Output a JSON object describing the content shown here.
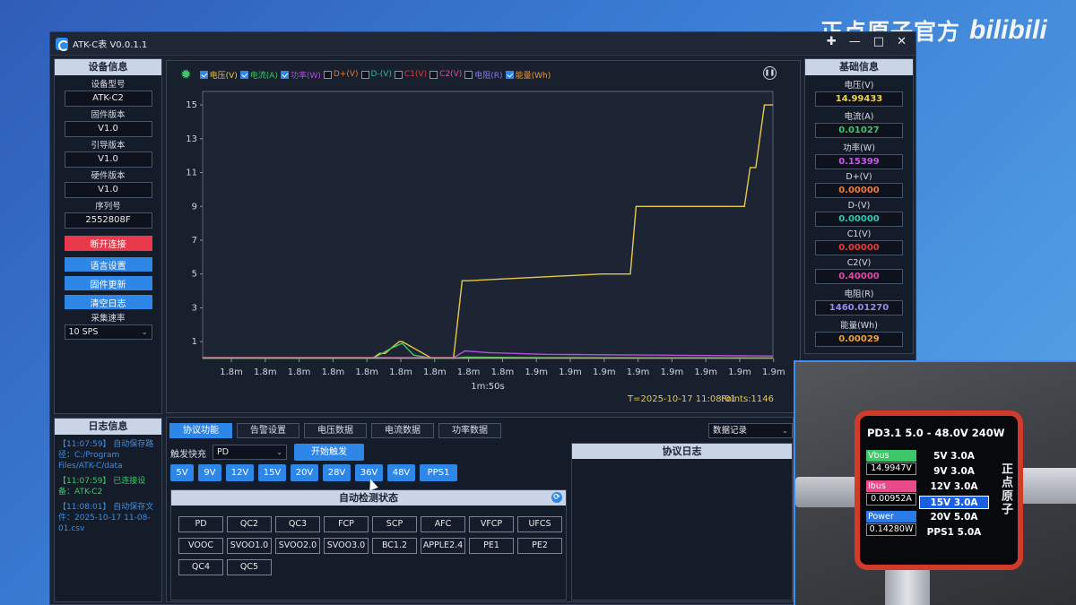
{
  "watermark": {
    "brand": "正点原子官方",
    "site": "bilibili"
  },
  "app": {
    "title": "ATK-C表 V0.0.1.1"
  },
  "device_info": {
    "title": "设备信息",
    "fields": [
      {
        "label": "设备型号",
        "value": "ATK-C2"
      },
      {
        "label": "固件版本",
        "value": "V1.0"
      },
      {
        "label": "引导版本",
        "value": "V1.0"
      },
      {
        "label": "硬件版本",
        "value": "V1.0"
      },
      {
        "label": "序列号",
        "value": "2552808F"
      }
    ],
    "disconnect": "断开连接",
    "lang": "语言设置",
    "fw_update": "固件更新",
    "clear_log": "清空日志",
    "rate_label": "采集速率",
    "rate_value": "10 SPS"
  },
  "log": {
    "title": "日志信息",
    "entries": [
      {
        "text": "【11:07:59】 自动保存路径：C:/Program Files/ATK-C/data",
        "color": "blue"
      },
      {
        "text": "【11:07:59】 已连接设备：ATK-C2",
        "color": "green"
      },
      {
        "text": "【11:08:01】 自动保存文件：2025-10-17 11-08-01.csv",
        "color": "blue"
      }
    ]
  },
  "legend": [
    {
      "label": "电压(V)",
      "checked": true,
      "color": "#e8c84a"
    },
    {
      "label": "电流(A)",
      "checked": true,
      "color": "#3ec66b"
    },
    {
      "label": "功率(W)",
      "checked": true,
      "color": "#b04fe0"
    },
    {
      "label": "D+(V)",
      "checked": false,
      "color": "#e07a3a"
    },
    {
      "label": "D-(V)",
      "checked": false,
      "color": "#2fb8a8"
    },
    {
      "label": "C1(V)",
      "checked": false,
      "color": "#e03a3a"
    },
    {
      "label": "C2(V)",
      "checked": false,
      "color": "#e04aa8"
    },
    {
      "label": "电阻(R)",
      "checked": false,
      "color": "#8a7ae8"
    },
    {
      "label": "能量(Wh)",
      "checked": true,
      "color": "#e89a3a"
    }
  ],
  "chart_data": {
    "type": "line",
    "y_ticks": [
      "15",
      "13",
      "11",
      "9",
      "7",
      "5",
      "3",
      "1"
    ],
    "ylim": [
      0,
      15.8
    ],
    "x_ticks": [
      "1.8m",
      "1.8m",
      "1.8m",
      "1.8m",
      "1.8m",
      "1.8m",
      "1.8m",
      "1.8m",
      "1.8m",
      "1.9m",
      "1.9m",
      "1.9m",
      "1.9m",
      "1.9m",
      "1.9m",
      "1.9m",
      "1.9m"
    ],
    "x_center_label": "1m:50s",
    "timestamp": "T=2025-10-17 11:08:01",
    "points": "Points:1146",
    "series": [
      {
        "color": "#e8c84a",
        "x": [
          0,
          0.3,
          0.31,
          0.32,
          0.33,
          0.345,
          0.35,
          0.4,
          0.41,
          0.42,
          0.43,
          0.44,
          0.455,
          0.465,
          0.7,
          0.71,
          0.75,
          0.76,
          0.94,
          0.95,
          0.96,
          0.97,
          0.985,
          0.99,
          1.0
        ],
        "y": [
          0.05,
          0.05,
          0.3,
          0.3,
          0.6,
          1.0,
          1.0,
          0.05,
          0.05,
          0.05,
          0.05,
          0.05,
          4.6,
          4.6,
          5.0,
          5.0,
          5.0,
          9.0,
          9.0,
          9.0,
          11.3,
          11.3,
          15.0,
          15.0,
          15.0
        ]
      },
      {
        "color": "#3ec66b",
        "x": [
          0,
          0.3,
          0.33,
          0.35,
          0.37,
          0.4,
          0.44,
          0.46,
          0.6,
          0.8,
          1.0
        ],
        "y": [
          0.02,
          0.02,
          0.6,
          0.9,
          0.2,
          0.02,
          0.02,
          0.08,
          0.05,
          0.04,
          0.03
        ]
      },
      {
        "color": "#b04fe0",
        "x": [
          0,
          0.44,
          0.46,
          0.5,
          0.6,
          0.8,
          1.0
        ],
        "y": [
          0.05,
          0.05,
          0.45,
          0.35,
          0.25,
          0.2,
          0.15
        ]
      },
      {
        "color": "#e89a3a",
        "x": [
          0,
          0.5,
          1.0
        ],
        "y": [
          0.03,
          0.03,
          0.03
        ]
      }
    ]
  },
  "tabs": [
    "协议功能",
    "告警设置",
    "电压数据",
    "电流数据",
    "功率数据"
  ],
  "record_select": "数据记录",
  "trigger": {
    "label": "触发快充",
    "protocol": "PD",
    "start": "开始触发"
  },
  "voltages": [
    "5V",
    "9V",
    "12V",
    "15V",
    "20V",
    "28V",
    "36V",
    "48V",
    "PPS1"
  ],
  "auto_detect": {
    "title": "自动检测状态",
    "protocols": [
      "PD",
      "QC2",
      "QC3",
      "FCP",
      "SCP",
      "AFC",
      "VFCP",
      "UFCS",
      "VOOC",
      "SVOO1.0",
      "SVOO2.0",
      "SVOO3.0",
      "BC1.2",
      "APPLE2.4",
      "PE1",
      "PE2",
      "QC4",
      "QC5"
    ]
  },
  "proto_log": {
    "title": "协议日志"
  },
  "basic_info": {
    "title": "基础信息",
    "fields": [
      {
        "label": "电压(V)",
        "value": "14.99433",
        "color": "#f0d24a"
      },
      {
        "label": "电流(A)",
        "value": "0.01027",
        "color": "#3ec66b"
      },
      {
        "label": "功率(W)",
        "value": "0.15399",
        "color": "#c45ae6"
      },
      {
        "label": "D+(V)",
        "value": "0.00000",
        "color": "#f07a3a"
      },
      {
        "label": "D-(V)",
        "value": "0.00000",
        "color": "#2fc8b4"
      },
      {
        "label": "C1(V)",
        "value": "0.00000",
        "color": "#e83a3a"
      },
      {
        "label": "C2(V)",
        "value": "0.40000",
        "color": "#e04aa8"
      },
      {
        "label": "电阻(R)",
        "value": "1460.01270",
        "color": "#9a8af0"
      },
      {
        "label": "能量(Wh)",
        "value": "0.00029",
        "color": "#f0a03a"
      }
    ]
  },
  "device_screen": {
    "header": "PD3.1  5.0 - 48.0V 240W",
    "vbus_label": "Vbus",
    "vbus": "14.9947V",
    "ibus_label": "Ibus",
    "ibus": "0.00952A",
    "power_label": "Power",
    "power": "0.14280W",
    "options": [
      "5V 3.0A",
      "9V 3.0A",
      "12V 3.0A",
      "15V 3.0A",
      "20V 5.0A",
      "PPS1 5.0A"
    ],
    "selected_index": 3,
    "brand": "正点原子"
  }
}
